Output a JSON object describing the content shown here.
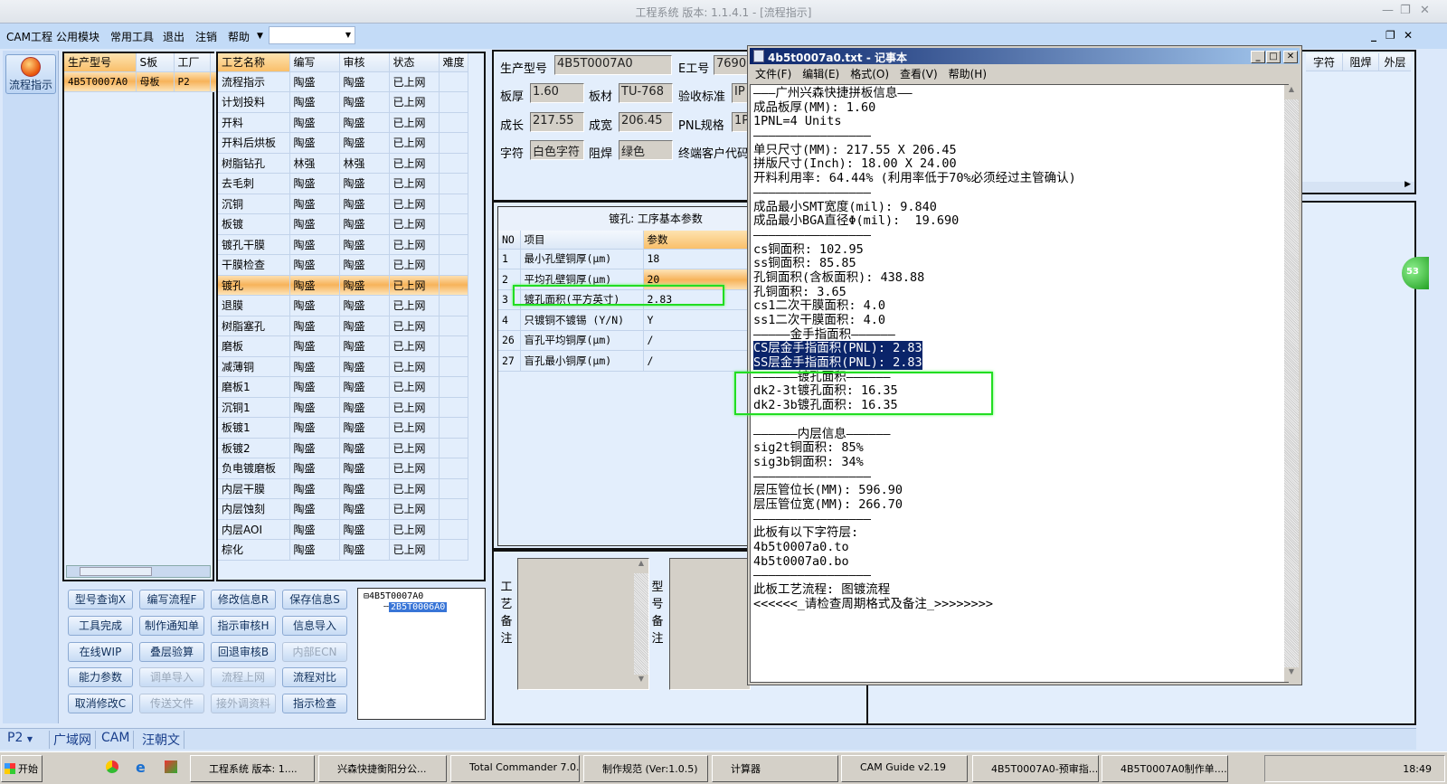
{
  "window": {
    "title": "工程系统  版本: 1.1.4.1 - [流程指示]"
  },
  "menu": {
    "items": [
      "CAM工程",
      "公用模块",
      "常用工具",
      "退出",
      "注销",
      "帮助"
    ],
    "combo_value": ""
  },
  "nav": {
    "button_label": "流程指示"
  },
  "model_table": {
    "headers": [
      "生产型号",
      "S板",
      "工厂"
    ],
    "rows": [
      [
        "4B5T0007A0",
        "母板",
        "P2"
      ]
    ]
  },
  "process_table": {
    "headers": [
      "工艺名称",
      "编写",
      "审核",
      "状态",
      "难度"
    ],
    "selected": "镀孔",
    "rows": [
      [
        "流程指示",
        "陶盛",
        "陶盛",
        "已上网",
        ""
      ],
      [
        "计划投料",
        "陶盛",
        "陶盛",
        "已上网",
        ""
      ],
      [
        "开料",
        "陶盛",
        "陶盛",
        "已上网",
        ""
      ],
      [
        "开料后烘板",
        "陶盛",
        "陶盛",
        "已上网",
        ""
      ],
      [
        "树脂钻孔",
        "林强",
        "林强",
        "已上网",
        ""
      ],
      [
        "去毛刺",
        "陶盛",
        "陶盛",
        "已上网",
        ""
      ],
      [
        "沉铜",
        "陶盛",
        "陶盛",
        "已上网",
        ""
      ],
      [
        "板镀",
        "陶盛",
        "陶盛",
        "已上网",
        ""
      ],
      [
        "镀孔干膜",
        "陶盛",
        "陶盛",
        "已上网",
        ""
      ],
      [
        "干膜检查",
        "陶盛",
        "陶盛",
        "已上网",
        ""
      ],
      [
        "镀孔",
        "陶盛",
        "陶盛",
        "已上网",
        ""
      ],
      [
        "退膜",
        "陶盛",
        "陶盛",
        "已上网",
        ""
      ],
      [
        "树脂塞孔",
        "陶盛",
        "陶盛",
        "已上网",
        ""
      ],
      [
        "磨板",
        "陶盛",
        "陶盛",
        "已上网",
        ""
      ],
      [
        "减薄铜",
        "陶盛",
        "陶盛",
        "已上网",
        ""
      ],
      [
        "磨板1",
        "陶盛",
        "陶盛",
        "已上网",
        ""
      ],
      [
        "沉铜1",
        "陶盛",
        "陶盛",
        "已上网",
        ""
      ],
      [
        "板镀1",
        "陶盛",
        "陶盛",
        "已上网",
        ""
      ],
      [
        "板镀2",
        "陶盛",
        "陶盛",
        "已上网",
        ""
      ],
      [
        "负电镀磨板",
        "陶盛",
        "陶盛",
        "已上网",
        ""
      ],
      [
        "内层干膜",
        "陶盛",
        "陶盛",
        "已上网",
        ""
      ],
      [
        "内层蚀刻",
        "陶盛",
        "陶盛",
        "已上网",
        ""
      ],
      [
        "内层AOI",
        "陶盛",
        "陶盛",
        "已上网",
        ""
      ],
      [
        "棕化",
        "陶盛",
        "陶盛",
        "已上网",
        ""
      ]
    ]
  },
  "buttons": [
    {
      "label": "型号查询X",
      "enabled": true
    },
    {
      "label": "编写流程F",
      "enabled": true
    },
    {
      "label": "修改信息R",
      "enabled": true
    },
    {
      "label": "保存信息S",
      "enabled": true
    },
    {
      "label": "工具完成",
      "enabled": true
    },
    {
      "label": "制作通知单",
      "enabled": true
    },
    {
      "label": "指示审核H",
      "enabled": true
    },
    {
      "label": "信息导入",
      "enabled": true
    },
    {
      "label": "在线WIP",
      "enabled": true
    },
    {
      "label": "叠层验算",
      "enabled": true
    },
    {
      "label": "回退审核B",
      "enabled": true
    },
    {
      "label": "内部ECN",
      "enabled": false
    },
    {
      "label": "能力参数",
      "enabled": true
    },
    {
      "label": "调单导入",
      "enabled": false
    },
    {
      "label": "流程上网",
      "enabled": false
    },
    {
      "label": "流程对比",
      "enabled": true
    },
    {
      "label": "取消修改C",
      "enabled": true
    },
    {
      "label": "传送文件",
      "enabled": false
    },
    {
      "label": "接外调资料",
      "enabled": false
    },
    {
      "label": "指示检查",
      "enabled": true
    }
  ],
  "tree": {
    "root": "4B5T0007A0",
    "child": "2B5T0006A0"
  },
  "info": {
    "fields": [
      {
        "label": "生产型号",
        "value": "4B5T0007A0"
      },
      {
        "label": "E工号",
        "value": "7690"
      },
      {
        "label": "板厚",
        "value": "1.60"
      },
      {
        "label": "板材",
        "value": "TU-768"
      },
      {
        "label": "验收标准",
        "value": "IP"
      },
      {
        "label": "成长",
        "value": "217.55"
      },
      {
        "label": "成宽",
        "value": "206.45"
      },
      {
        "label": "PNL规格",
        "value": "1P"
      },
      {
        "label": "字符",
        "value": "白色字符"
      },
      {
        "label": "阻焊",
        "value": "绿色"
      },
      {
        "label": "终端客户代码",
        "value": ""
      }
    ]
  },
  "params": {
    "title": "镀孔: 工序基本参数",
    "headers": [
      "NO",
      "项目",
      "参数"
    ],
    "rows": [
      [
        "1",
        "最小孔壁铜厚(μm)",
        "18"
      ],
      [
        "2",
        "平均孔壁铜厚(μm)",
        "20"
      ],
      [
        "3",
        "镀孔面积(平方英寸)",
        "2.83"
      ],
      [
        "4",
        "只镀铜不镀锡 (Y/N)",
        "Y"
      ],
      [
        "26",
        "盲孔平均铜厚(μm)",
        "/"
      ],
      [
        "27",
        "盲孔最小铜厚(μm)",
        "/"
      ]
    ]
  },
  "notes": {
    "process_label": "工艺备注",
    "model_label": "型号备注",
    "process_value": "",
    "model_value": ""
  },
  "right_table": {
    "headers": [
      "字符",
      "阻焊",
      "外层"
    ]
  },
  "badge": "53",
  "notepad": {
    "title": "4b5t0007a0.txt - 记事本",
    "menu": [
      "文件(F)",
      "编辑(E)",
      "格式(O)",
      "查看(V)",
      "帮助(H)"
    ],
    "lines": [
      "———广州兴森快捷拼板信息——",
      "成品板厚(MM): 1.60",
      "1PNL=4 Units",
      "————————————————",
      "单只尺寸(MM): 217.55 X 206.45",
      "拼版尺寸(Inch): 18.00 X 24.00",
      "开料利用率: 64.44% (利用率低于70%必须经过主管确认)",
      "————————————————",
      "成品最小SMT宽度(mil): 9.840",
      "成品最小BGA直径Φ(mil):  19.690",
      "————————————————",
      "cs铜面积: 102.95",
      "ss铜面积: 85.85",
      "孔铜面积(含板面积): 438.88",
      "孔铜面积: 3.65",
      "cs1二次干膜面积: 4.0",
      "ss1二次干膜面积: 4.0",
      "—————金手指面积——————",
      "CS层金手指面积(PNL): 2.83",
      "SS层金手指面积(PNL): 2.83",
      "——————镀孔面积——————",
      "dk2-3t镀孔面积: 16.35",
      "dk2-3b镀孔面积: 16.35",
      "",
      "——————内层信息——————",
      "sig2t铜面积: 85%",
      "sig3b铜面积: 34%",
      "————————————————",
      "层压管位长(MM): 596.90",
      "层压管位宽(MM): 266.70",
      "————————————————",
      "此板有以下字符层:",
      "4b5t0007a0.to",
      "4b5t0007a0.bo",
      "————————————————",
      "此板工艺流程: 图镀流程",
      "<<<<<<_请检查周期格式及备注_>>>>>>>>"
    ],
    "highlighted_lines": [
      18,
      19
    ]
  },
  "statusbar": {
    "factory": "P2",
    "tabs": [
      "广域网",
      "CAM",
      "汪朝文"
    ]
  },
  "taskbar": {
    "start": "开始",
    "tasks": [
      "工程系统  版本: 1....",
      "兴森快捷衡阳分公...",
      "Total Commander 7.0...",
      "制作规范 (Ver:1.0.5)",
      "计算器",
      "CAM Guide v2.19",
      "4B5T0007A0-预审指...",
      "4B5T0007A0制作单...."
    ],
    "clock": "18:49"
  },
  "colors": {
    "accent_orange": "#f7b35a",
    "highlight_green": "#22dd22",
    "selection_blue": "#0a246a"
  }
}
